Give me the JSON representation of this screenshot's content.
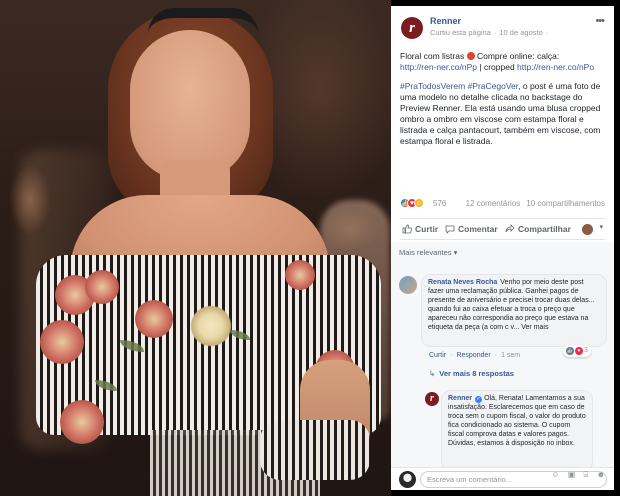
{
  "post": {
    "page_name": "Renner",
    "avatar_letter": "r",
    "meta": {
      "action": "Curtiu esta página",
      "separator": "·",
      "date": "10 de agosto",
      "globe": "·"
    },
    "text_line1": "Floral com listras",
    "text_line1b": "Compre online: calça:",
    "link1": "http://ren-ner.co/nPp",
    "text_sep": " | cropped ",
    "link2": "http://ren-ner.co/nPo",
    "hashtags": "#PraTodosVerem #PraCegoVer",
    "description": ", o post é uma foto de uma modelo no detalhe clicada no backstage do Preview Renner. Ela está usando uma blusa cropped ombro a ombro em viscose com estampa floral e listrada e calça pantacourt, também em viscose, com estampa floral e listrada."
  },
  "reactions": {
    "count": "576",
    "comments": "12 comentários",
    "shares": "10 compartilhamentos"
  },
  "actions": {
    "like": "Curtir",
    "comment": "Comentar",
    "share": "Compartilhar",
    "caret": "▾"
  },
  "comments": {
    "filter_label": "Mais relevantes",
    "filter_caret": "▾",
    "c1": {
      "author": "Renata Neves Rocha",
      "text": "Venho por meio deste post fazer uma reclamação pública. Ganhei pagos de presente de aniversário e precisei trocar duas delas... quando fui ao caixa efetuar a troca o preço que apareceu não correspondia ao preço que estava na etiqueta da peça (a com c v... Ver mais",
      "like": "Curtir",
      "reply": "Responder",
      "age": "1 sem",
      "dot": "·",
      "react_count": "3"
    },
    "view_replies": "Ver mais 8 respostas",
    "c2": {
      "author": "Renner",
      "text": "Olá, Renata! Lamentamos a sua insatisfação. Esclarecemos que em caso de troca sem o cupom fiscal, o valor do produto fica condicionado ao sistema. O cupom fiscal comprova datas e valores pagos. Dúvidas, estamos à disposição no inbox."
    },
    "write_placeholder": "Escreva um comentário...",
    "write_icons": "☺ ▣ ⌸ ☻"
  },
  "colors": {
    "brand": "#7d1c20",
    "link": "#365899",
    "like_blue": "#2e7bf6"
  }
}
